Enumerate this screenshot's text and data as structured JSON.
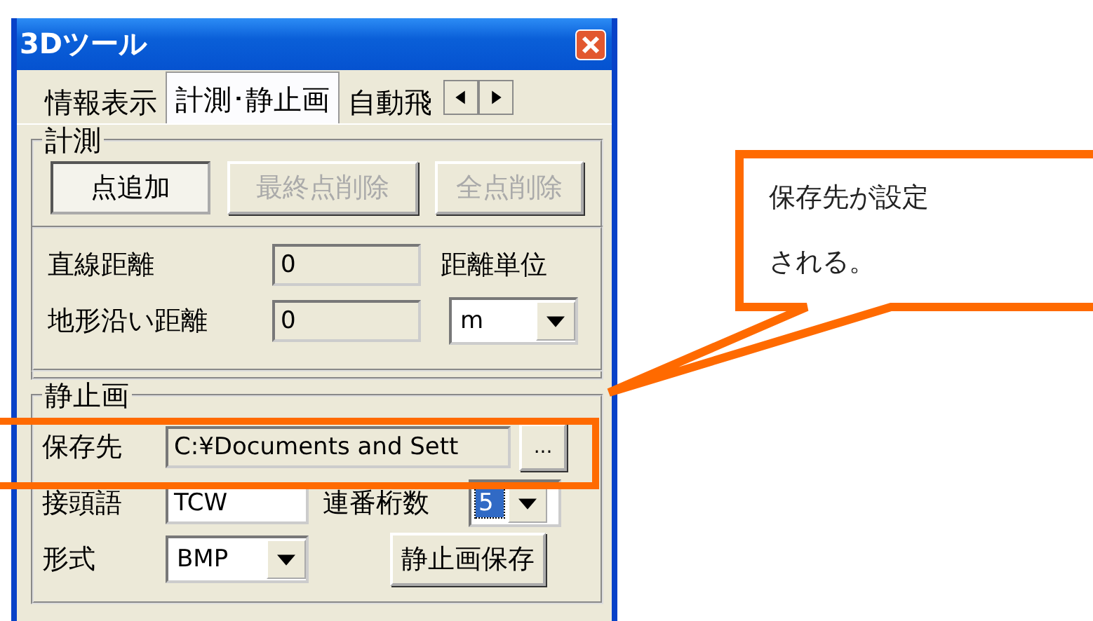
{
  "window": {
    "title": "3Dツール"
  },
  "tabs": [
    {
      "label": "情報表示",
      "selected": false
    },
    {
      "label": "計測･静止画",
      "selected": true
    },
    {
      "label": "自動飛",
      "selected": false
    }
  ],
  "measurement": {
    "title": "計測",
    "buttons": [
      {
        "label": "点追加",
        "pressed": true,
        "disabled": false
      },
      {
        "label": "最終点削除",
        "pressed": false,
        "disabled": true
      },
      {
        "label": "全点削除",
        "pressed": false,
        "disabled": true
      }
    ],
    "straight_distance": {
      "label": "直線距離",
      "value": "0"
    },
    "terrain_distance": {
      "label": "地形沿い距離",
      "value": "0"
    },
    "unit": {
      "label": "距離単位",
      "value": "m"
    }
  },
  "still_image": {
    "title": "静止画",
    "save_to": {
      "label": "保存先",
      "value": "C:¥Documents and Sett",
      "browse": "..."
    },
    "prefix": {
      "label": "接頭語",
      "value": "TCW"
    },
    "digits": {
      "label": "連番桁数",
      "value": "5",
      "selected": true
    },
    "format": {
      "label": "形式",
      "value": "BMP"
    },
    "save_button": "静止画保存"
  },
  "callout": {
    "lines": [
      "保存先が設定",
      "される。"
    ]
  }
}
